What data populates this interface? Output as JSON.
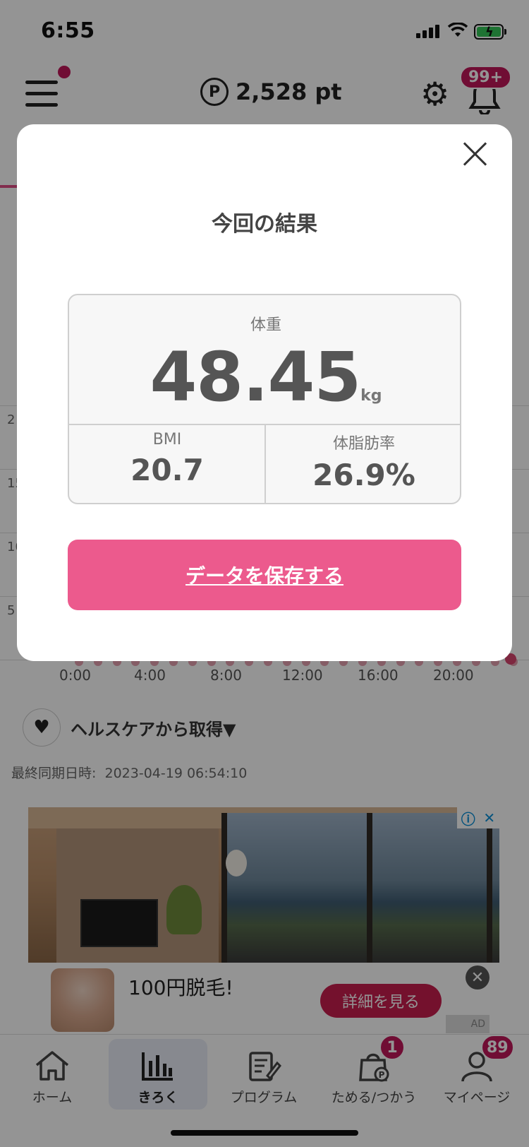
{
  "status_bar": {
    "time": "6:55"
  },
  "header": {
    "points": "2,528 pt",
    "points_icon_letter": "P",
    "notification_badge": "99+"
  },
  "chart_bg": {
    "y_ticks": [
      "2",
      "15",
      "10",
      "5"
    ],
    "x_ticks": [
      "0:00",
      "4:00",
      "8:00",
      "12:00",
      "16:00",
      "20:00"
    ]
  },
  "health": {
    "label": "ヘルスケアから取得▼",
    "last_sync_label": "最終同期日時:",
    "last_sync_value": "2023-04-19 06:54:10"
  },
  "ad": {
    "title": "100円脱毛!",
    "cta": "詳細を見る",
    "tag": "AD",
    "info_glyph": "ⓘ",
    "close_glyph": "✕"
  },
  "tabbar": {
    "items": [
      {
        "label": "ホーム",
        "icon": "home-icon"
      },
      {
        "label": "きろく",
        "icon": "bar-chart-icon",
        "active": true
      },
      {
        "label": "プログラム",
        "icon": "program-icon"
      },
      {
        "label": "ためる/つかう",
        "icon": "points-bag-icon",
        "badge": "1"
      },
      {
        "label": "マイページ",
        "icon": "user-icon",
        "badge": "89"
      }
    ]
  },
  "modal": {
    "title": "今回の結果",
    "weight_label": "体重",
    "weight_value": "48.45",
    "weight_unit": "kg",
    "bmi_label": "BMI",
    "bmi_value": "20.7",
    "body_fat_label": "体脂肪率",
    "body_fat_value": "26.9%",
    "save_button": "データを保存する"
  },
  "colors": {
    "accent": "#ec5a8d",
    "badge": "#c2185b",
    "overlay": "rgba(0,0,0,0.42)"
  }
}
